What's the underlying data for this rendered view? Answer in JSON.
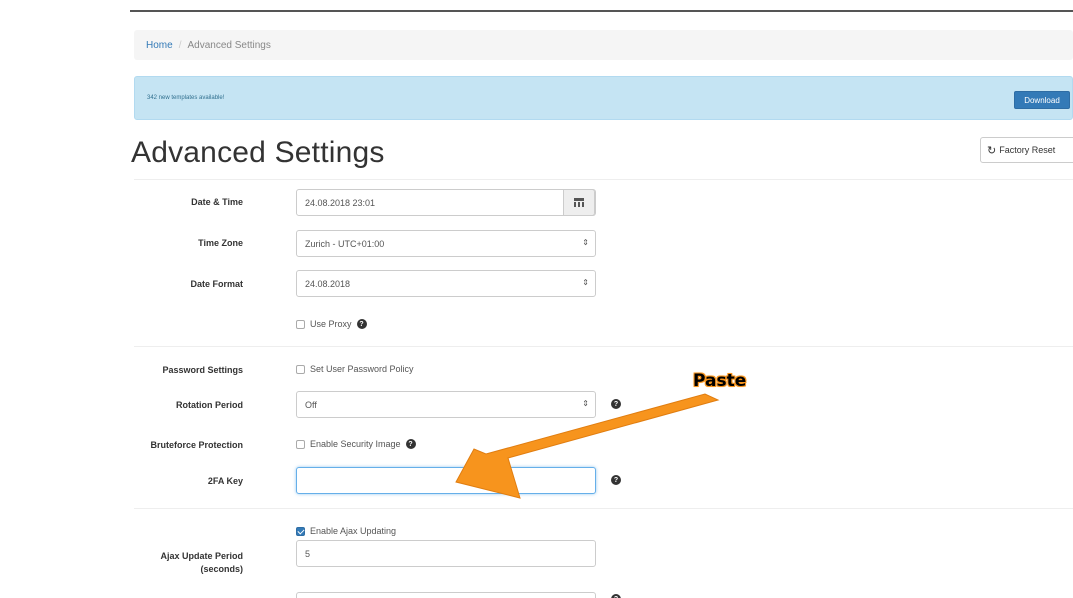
{
  "breadcrumb": {
    "home": "Home",
    "separator": "/",
    "current": "Advanced Settings"
  },
  "alert": {
    "text": "342 new templates available!",
    "button": "Download"
  },
  "page": {
    "title": "Advanced Settings",
    "reset_button": "Factory Reset"
  },
  "form": {
    "date_time": {
      "label": "Date & Time",
      "value": "24.08.2018 23:01",
      "icon": "calendar-icon"
    },
    "time_zone": {
      "label": "Time Zone",
      "value": "Zurich - UTC+01:00"
    },
    "date_format": {
      "label": "Date Format",
      "value": "24.08.2018"
    },
    "use_proxy": {
      "label": "Use Proxy",
      "checked": false
    },
    "password_settings": {
      "label": "Password Settings",
      "checkbox_label": "Set User Password Policy",
      "checked": false
    },
    "rotation_period": {
      "label": "Rotation Period",
      "value": "Off"
    },
    "bruteforce": {
      "label": "Bruteforce Protection",
      "checkbox_label": "Enable Security Image",
      "checked": false
    },
    "twofa_key": {
      "label": "2FA Key",
      "value": ""
    },
    "ajax": {
      "checkbox_label": "Enable Ajax Updating",
      "checked": true,
      "period_label_1": "Ajax Update Period",
      "period_label_2": "(seconds)",
      "period_value": "5"
    }
  },
  "annotation": {
    "text": "Paste",
    "color": "#f7941d"
  },
  "icons": {
    "help": "question-circle-icon",
    "select_caret": "updown-caret-icon",
    "refresh": "refresh-icon"
  },
  "colors": {
    "primary": "#337ab7",
    "alert_bg": "#c5e4f3",
    "focus": "#66afe9"
  }
}
